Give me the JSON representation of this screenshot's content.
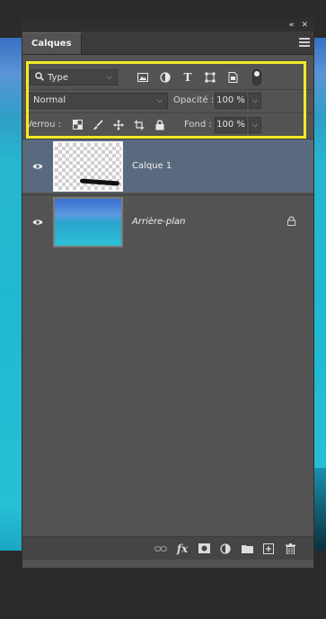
{
  "window": {
    "collapse_glyph": "«",
    "close_glyph": "✕"
  },
  "panel": {
    "tab_label": "Calques"
  },
  "filter": {
    "kind_label": "Type",
    "icons": [
      "image-filter-icon",
      "adjustment-filter-icon",
      "text-filter-icon",
      "shape-filter-icon",
      "smart-object-filter-icon"
    ]
  },
  "blend": {
    "mode": "Normal",
    "opacity_label": "Opacité :",
    "opacity_value": "100 %"
  },
  "lock": {
    "label": "Verrou :",
    "fill_label": "Fond :",
    "fill_value": "100 %"
  },
  "layers": [
    {
      "name": "Calque 1",
      "selected": true,
      "visible": true
    },
    {
      "name": "Arrière-plan",
      "selected": false,
      "visible": true,
      "locked": true
    }
  ],
  "footer": {
    "icons": [
      "link-layers-icon",
      "fx-icon",
      "add-mask-icon",
      "adjustment-layer-icon",
      "new-group-icon",
      "new-layer-icon",
      "delete-icon"
    ],
    "fx_label": "fx"
  },
  "colors": {
    "highlight": "#f3ea26",
    "selected_layer": "#5a6a7e",
    "panel_bg": "#535353"
  }
}
